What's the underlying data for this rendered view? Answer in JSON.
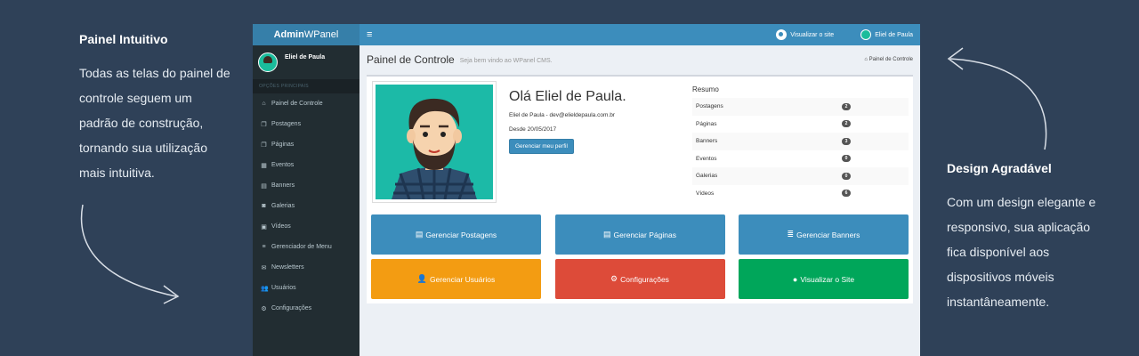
{
  "left_promo": {
    "title": "Painel Intuitivo",
    "text": "Todas as telas do painel de controle seguem um padrão de construção, tornando sua utilização mais intuitiva."
  },
  "right_promo": {
    "title": "Design Agradável",
    "text": "Com um design elegante e responsivo, sua aplicação fica disponível aos dispositivos móveis instantâneamente."
  },
  "app": {
    "logo_bold": "Admin",
    "logo_rest": "WPanel",
    "toggle_icon": "≡",
    "top_view_site": "Visualizar o site",
    "top_user": "Eliel de Paula",
    "sidebar": {
      "user_name": "Eliel de Paula",
      "section_header": "OPÇÕES PRINCIPAIS",
      "items": [
        {
          "icon": "⌂",
          "label": "Painel de Controle"
        },
        {
          "icon": "❐",
          "label": "Postagens"
        },
        {
          "icon": "❐",
          "label": "Páginas"
        },
        {
          "icon": "▦",
          "label": "Eventos"
        },
        {
          "icon": "▤",
          "label": "Banners"
        },
        {
          "icon": "◙",
          "label": "Galerias"
        },
        {
          "icon": "▣",
          "label": "Vídeos"
        },
        {
          "icon": "≡",
          "label": "Gerenciador de Menu"
        },
        {
          "icon": "✉",
          "label": "Newsletters"
        },
        {
          "icon": "👥",
          "label": "Usuários"
        },
        {
          "icon": "⚙",
          "label": "Configurações"
        }
      ]
    },
    "page": {
      "title": "Painel de Controle",
      "subtitle": "Seja bem vindo ao WPanel CMS.",
      "breadcrumb": "Painel de Controle"
    },
    "profile": {
      "greeting": "Olá Eliel de Paula.",
      "email_line": "Eliel de Paula - dev@elieldepaula.com.br",
      "since": "Desde 20/05/2017",
      "manage_button": "Gerenciar meu perfil"
    },
    "summary": {
      "title": "Resumo",
      "rows": [
        {
          "label": "Postagens",
          "count": "2"
        },
        {
          "label": "Páginas",
          "count": "2"
        },
        {
          "label": "Banners",
          "count": "3"
        },
        {
          "label": "Eventos",
          "count": "0"
        },
        {
          "label": "Galerias",
          "count": "0"
        },
        {
          "label": "Vídeos",
          "count": "6"
        }
      ]
    },
    "tiles": [
      {
        "label": "Gerenciar Postagens",
        "icon": "▤",
        "color": "#3c8dbc"
      },
      {
        "label": "Gerenciar Páginas",
        "icon": "▤",
        "color": "#3c8dbc"
      },
      {
        "label": "Gerenciar Banners",
        "icon": "≣",
        "color": "#3c8dbc"
      },
      {
        "label": "Gerenciar Usuários",
        "icon": "👤",
        "color": "#f39c12"
      },
      {
        "label": "Configurações",
        "icon": "⚙",
        "color": "#dd4b39"
      },
      {
        "label": "Visualizar o Site",
        "icon": "●",
        "color": "#00a65a"
      }
    ]
  },
  "colors": {
    "background": "#2f4158",
    "topbar": "#3c8dbc",
    "sidebar": "#222d32"
  }
}
